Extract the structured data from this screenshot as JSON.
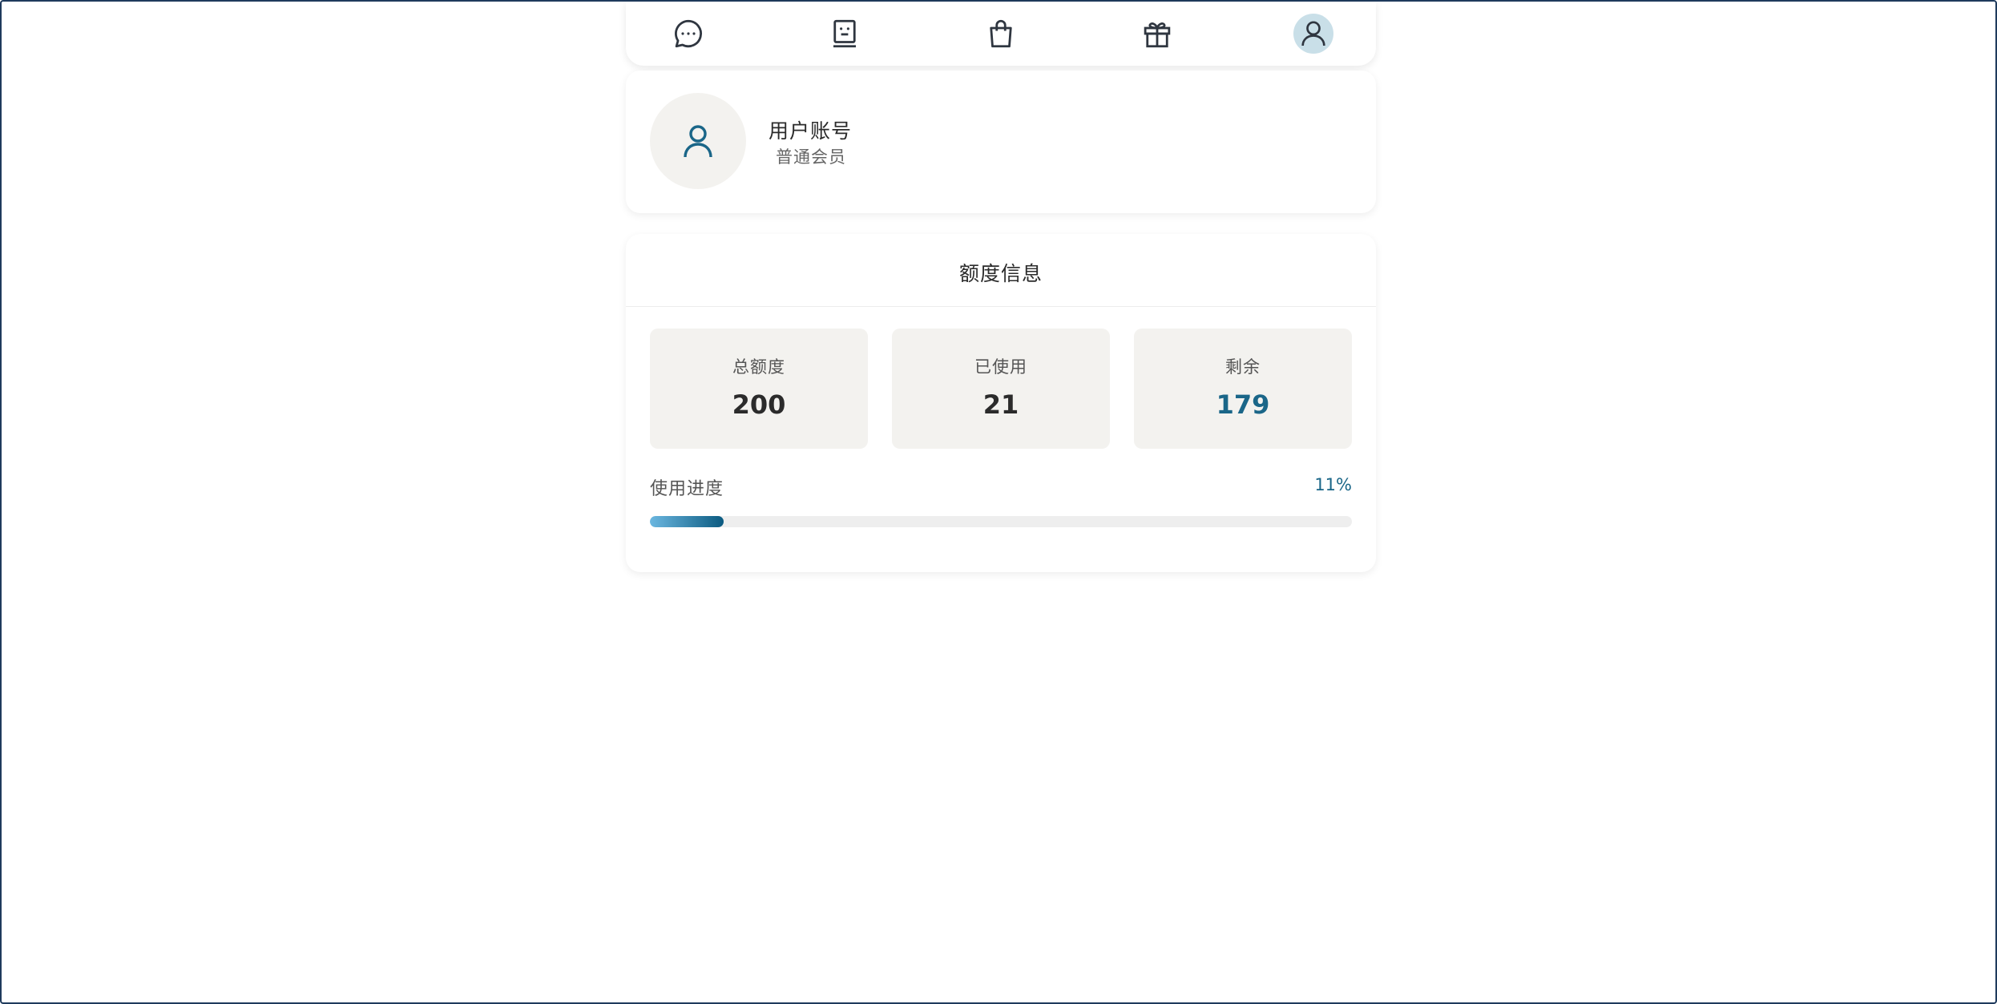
{
  "nav": {
    "items": [
      {
        "icon": "chat-bubble-icon",
        "active": false
      },
      {
        "icon": "robot-icon",
        "active": false
      },
      {
        "icon": "shopping-bag-icon",
        "active": false
      },
      {
        "icon": "gift-icon",
        "active": false
      },
      {
        "icon": "user-icon",
        "active": true
      }
    ]
  },
  "profile": {
    "name": "用户账号",
    "level": "普通会员"
  },
  "quota": {
    "title": "额度信息",
    "total_label": "总额度",
    "total_value": "200",
    "used_label": "已使用",
    "used_value": "21",
    "remaining_label": "剩余",
    "remaining_value": "179",
    "progress_label": "使用进度",
    "progress_text": "11%",
    "progress_fraction": 0.105
  },
  "colors": {
    "accent": "#1a6688",
    "card_bg": "#f3f2ef",
    "progress_start": "#6bb7e0",
    "progress_end": "#0b5a80"
  }
}
